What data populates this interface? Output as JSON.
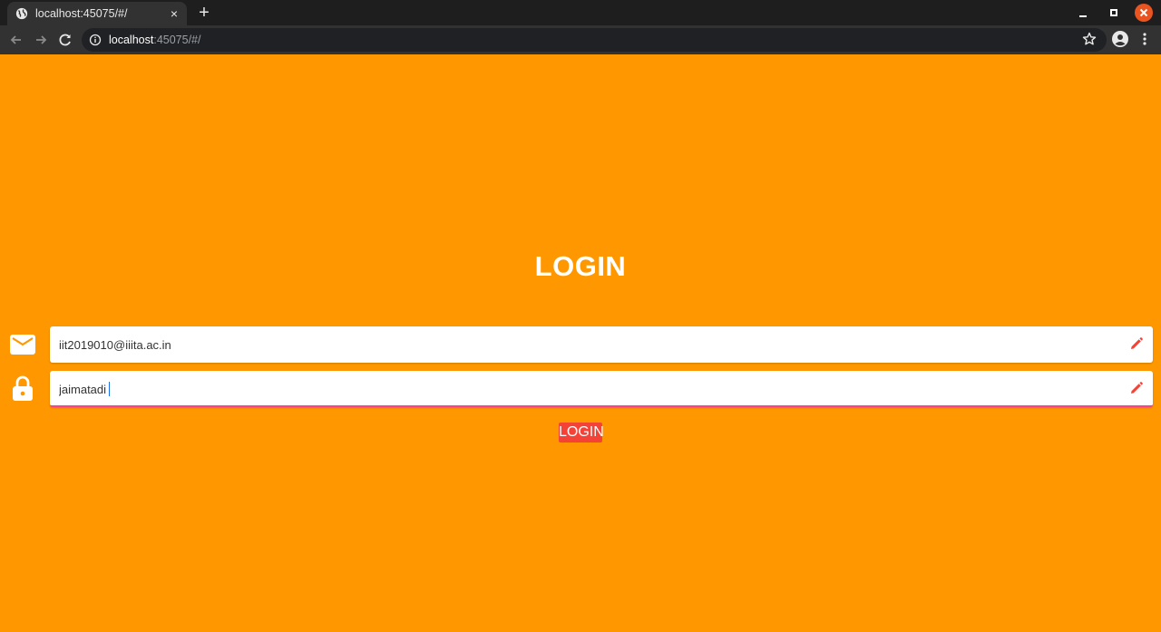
{
  "browser": {
    "tab_title": "localhost:45075/#/",
    "tab_close": "×",
    "new_tab": "+",
    "url_host": "localhost",
    "url_rest": ":45075/#/"
  },
  "page": {
    "title": "LOGIN",
    "email": {
      "value": "iit2019010@iiita.ac.in",
      "icon": "mail-icon"
    },
    "password": {
      "value": "jaimatadi",
      "icon": "lock-icon"
    },
    "login_button": "LOGIN"
  },
  "colors": {
    "background": "#ff9800",
    "button": "#f44336",
    "edit_icon": "#f44336",
    "focus_underline": "#ff4081"
  }
}
